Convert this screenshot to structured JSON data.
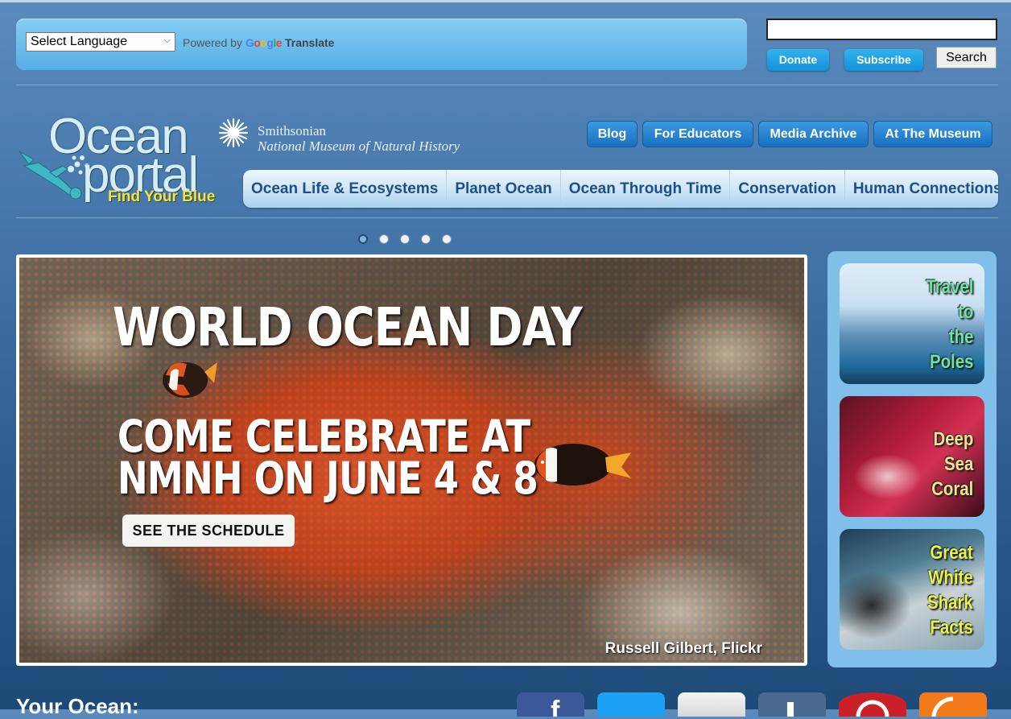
{
  "translate": {
    "select_value": "Select Language",
    "powered_prefix": "Powered by",
    "google_letters": [
      "G",
      "o",
      "o",
      "g",
      "l",
      "e"
    ],
    "translate_label": "Translate"
  },
  "utility": {
    "search_placeholder": "",
    "donate": "Donate",
    "subscribe": "Subscribe",
    "search_button": "Search"
  },
  "logo": {
    "line1": "Ocean",
    "line2": "portal",
    "tagline": "Find Your Blue"
  },
  "smithsonian": {
    "name": "Smithsonian",
    "museum": "National Museum of Natural History"
  },
  "top_nav": [
    "Blog",
    "For Educators",
    "Media Archive",
    "At The Museum"
  ],
  "main_nav": [
    "Ocean Life & Ecosystems",
    "Planet Ocean",
    "Ocean Through Time",
    "Conservation",
    "Human Connections"
  ],
  "carousel": {
    "slide_count": 5,
    "active_index": 0
  },
  "hero": {
    "title": "WORLD OCEAN DAY",
    "sub_line1": "COME CELEBRATE AT",
    "sub_line2": "NMNH ON JUNE 4 & 8",
    "cta": "SEE THE SCHEDULE",
    "credit": "Russell Gilbert, Flickr"
  },
  "promos": [
    {
      "lines": [
        "Travel",
        "to",
        "the",
        "Poles"
      ]
    },
    {
      "lines": [
        "Deep",
        "Sea",
        "Coral"
      ]
    },
    {
      "lines": [
        "Great",
        "White",
        "Shark",
        "Facts"
      ]
    }
  ],
  "bottom": {
    "heading": "Your Ocean:",
    "social_icons": [
      "facebook-icon",
      "twitter-icon",
      "email-icon",
      "tumblr-icon",
      "pinterest-icon",
      "rss-icon"
    ]
  },
  "colors": {
    "page_bg": "#4677ab",
    "nav_button": "#1b6fc0",
    "main_nav_text": "#1b4f8a",
    "pill_button": "#1093d9",
    "side_panel": "#7fbfea"
  }
}
